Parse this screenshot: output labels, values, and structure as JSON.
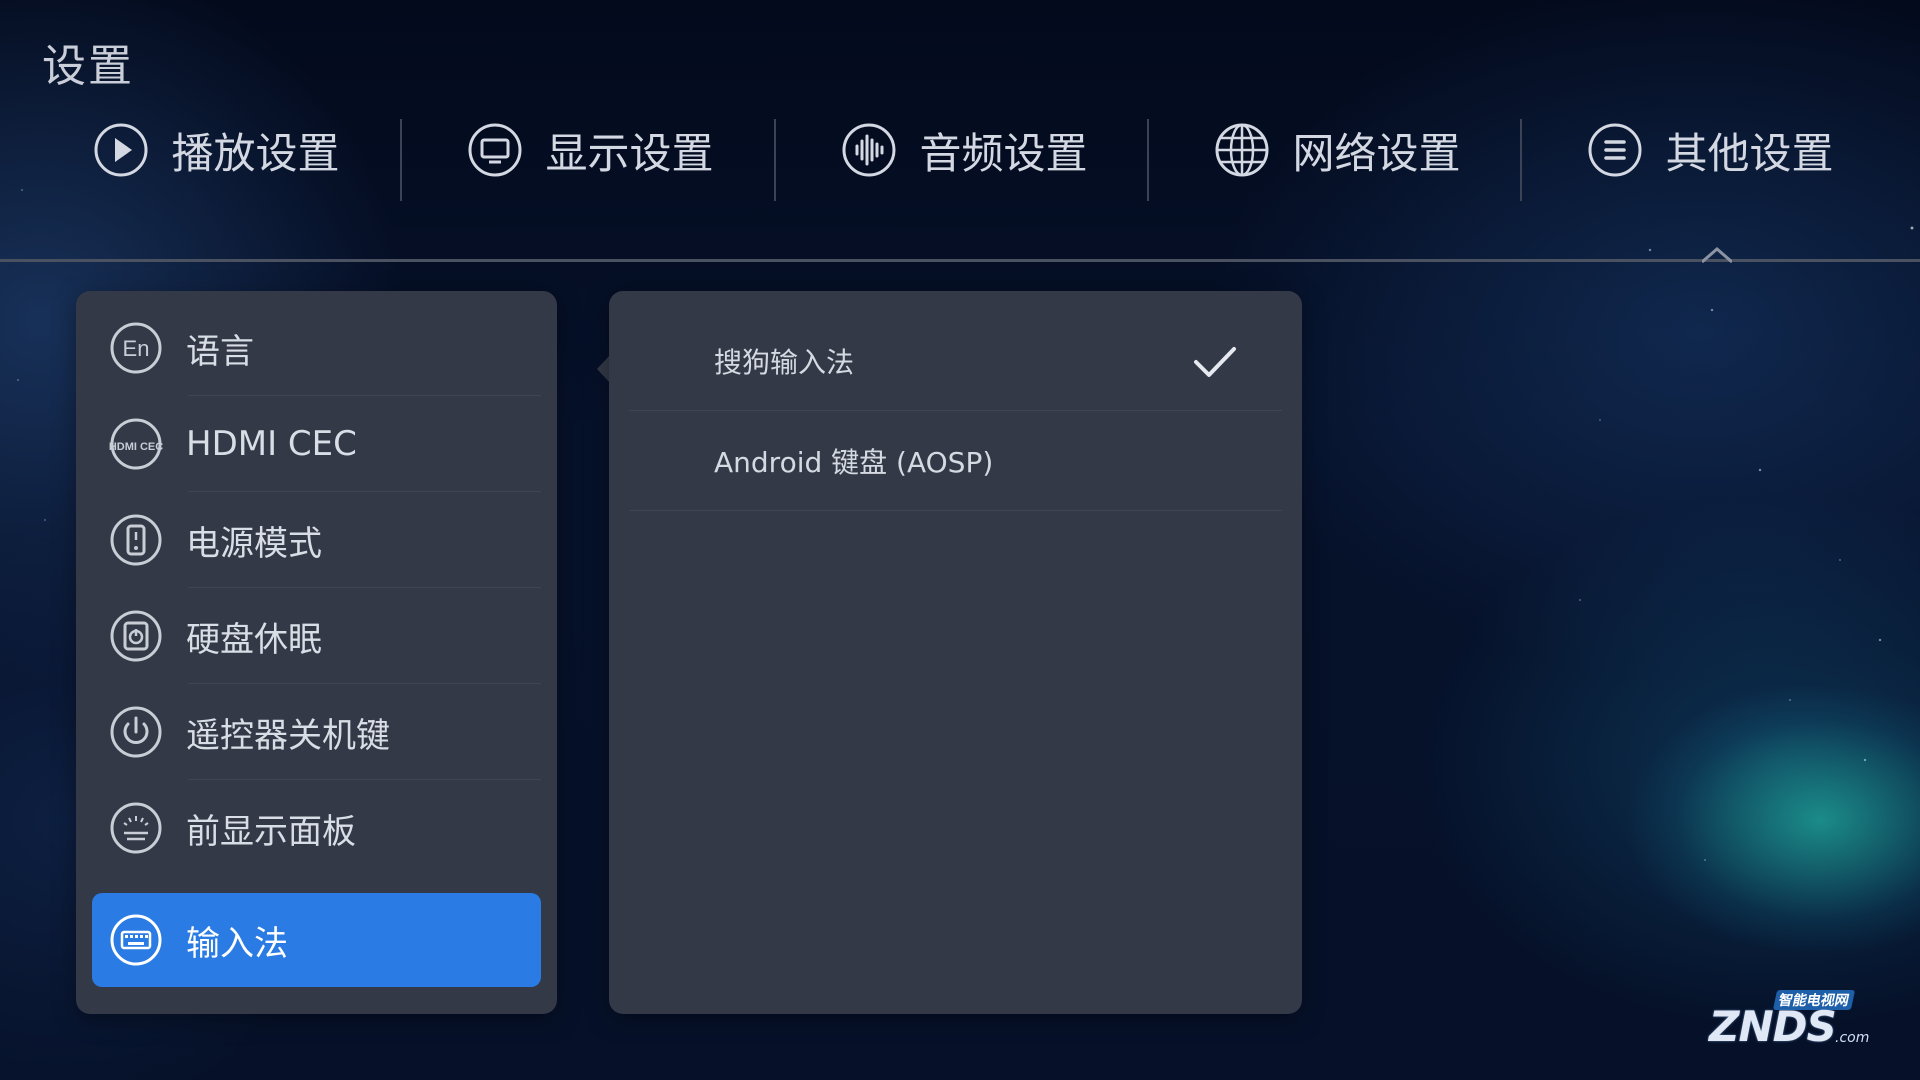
{
  "page": {
    "title": "设置"
  },
  "tabs": [
    {
      "label": "播放设置",
      "icon": "play-icon"
    },
    {
      "label": "显示设置",
      "icon": "monitor-icon"
    },
    {
      "label": "音频设置",
      "icon": "audio-wave-icon"
    },
    {
      "label": "网络设置",
      "icon": "globe-icon"
    },
    {
      "label": "其他设置",
      "icon": "menu-lines-icon",
      "selected": true
    }
  ],
  "menu": {
    "items": [
      {
        "label": "语言",
        "icon": "language-en-icon",
        "icon_text": "En"
      },
      {
        "label": "HDMI CEC",
        "icon": "hdmi-cec-icon",
        "icon_text": "HDMI CEC"
      },
      {
        "label": "电源模式",
        "icon": "power-mode-icon"
      },
      {
        "label": "硬盘休眠",
        "icon": "disk-sleep-icon"
      },
      {
        "label": "遥控器关机键",
        "icon": "power-icon"
      },
      {
        "label": "前显示面板",
        "icon": "front-panel-icon"
      },
      {
        "label": "输入法",
        "icon": "keyboard-icon",
        "active": true
      }
    ]
  },
  "detail": {
    "options": [
      {
        "label": "搜狗输入法",
        "checked": true
      },
      {
        "label": "Android 键盘 (AOSP)",
        "checked": false
      }
    ]
  },
  "watermark": {
    "top": "智能电视网",
    "main": "ZNDS",
    "suffix": ".com"
  },
  "colors": {
    "accent": "#2a7be3",
    "panel": "#333947",
    "background": "#06112a"
  }
}
